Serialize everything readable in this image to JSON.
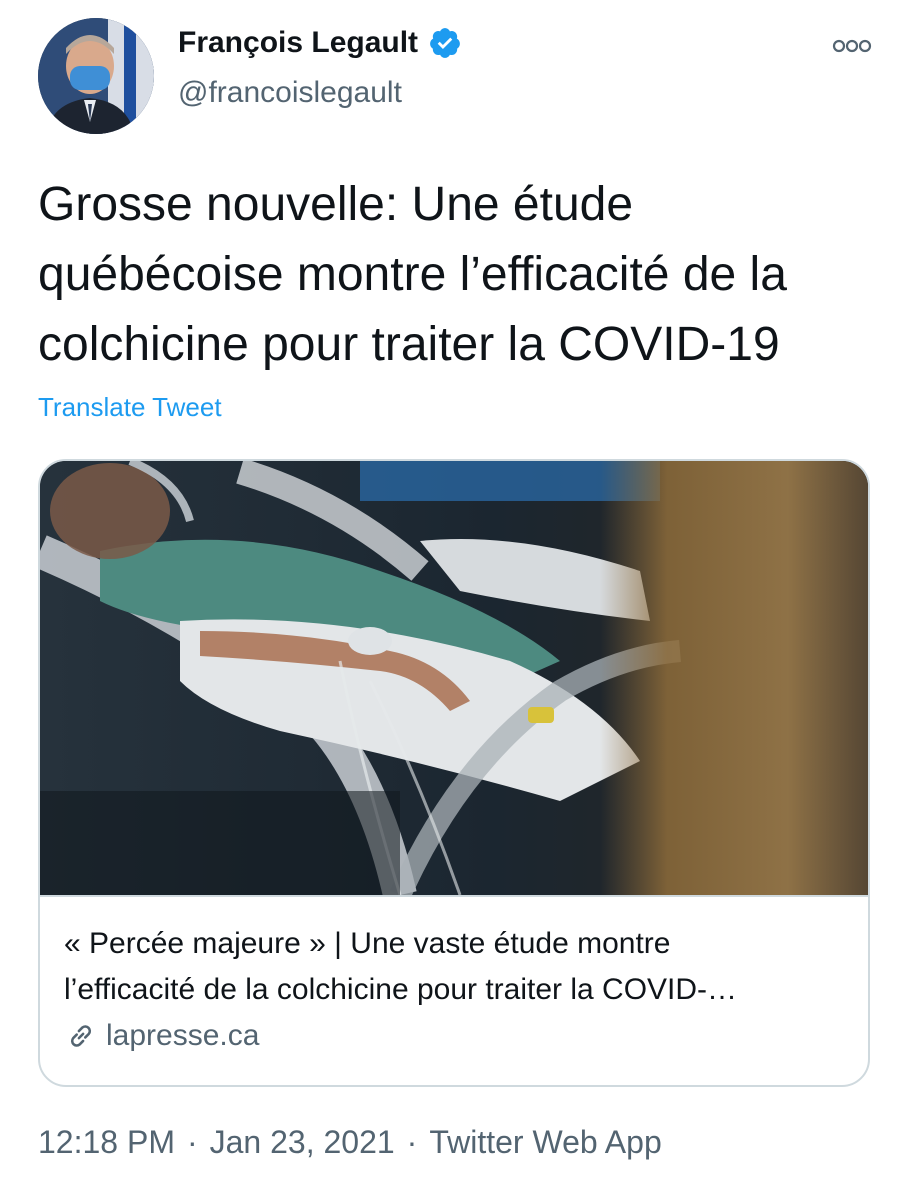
{
  "author": {
    "display_name": "François Legault",
    "handle": "@francoislegault",
    "verified_icon": "verified-badge-icon"
  },
  "tweet": {
    "text": "Grosse nouvelle: Une étude\nquébécoise montre l’efficacité de la\ncolchicine pour traiter la COVID-19",
    "translate_label": "Translate Tweet"
  },
  "card": {
    "title_line1": "« Percée majeure » | Une vaste étude montre",
    "title_line2": "l’efficacité de la colchicine pour traiter la COVID-…",
    "domain": "lapresse.ca"
  },
  "meta": {
    "time": "12:18 PM",
    "date": "Jan 23, 2021",
    "source": "Twitter Web App",
    "separator": "·"
  },
  "colors": {
    "link": "#1d9bf0",
    "verified": "#1d9bf0",
    "secondary_text": "#536471",
    "border": "#cfd9de"
  }
}
